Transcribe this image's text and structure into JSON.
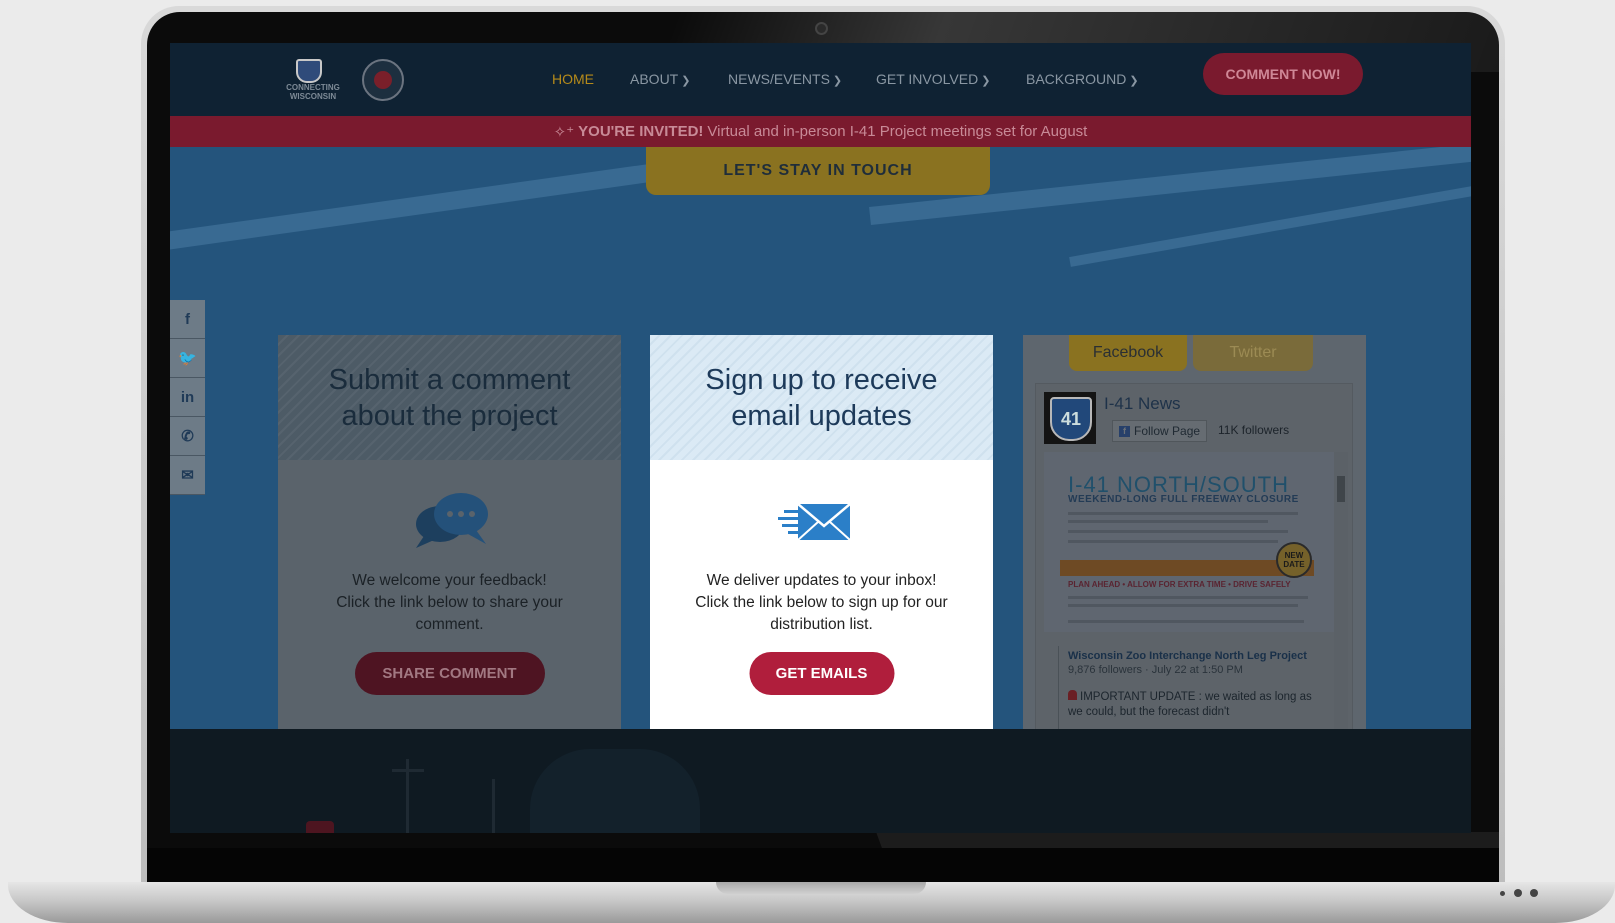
{
  "nav": {
    "logo_text": "CONNECTING WISCONSIN",
    "items": [
      {
        "label": "HOME",
        "chevron": false
      },
      {
        "label": "ABOUT",
        "chevron": true
      },
      {
        "label": "NEWS/EVENTS",
        "chevron": true
      },
      {
        "label": "GET INVOLVED",
        "chevron": true
      },
      {
        "label": "BACKGROUND",
        "chevron": true
      }
    ],
    "cta_label": "COMMENT NOW!"
  },
  "banner": {
    "icon": "sparkle-icon",
    "bold": "YOU'RE INVITED!",
    "text": "Virtual and in-person I-41 Project meetings set for August"
  },
  "stay_in_touch": "LET'S STAY IN TOUCH",
  "social": [
    {
      "icon": "facebook-icon",
      "glyph": "f"
    },
    {
      "icon": "twitter-icon",
      "glyph": "🐦"
    },
    {
      "icon": "linkedin-icon",
      "glyph": "in"
    },
    {
      "icon": "whatsapp-icon",
      "glyph": "✆"
    },
    {
      "icon": "email-icon",
      "glyph": "✉"
    }
  ],
  "cards": {
    "comment": {
      "title_line1": "Submit a comment",
      "title_line2": "about the project",
      "text_line1": "We welcome your feedback!",
      "text_line2": "Click the link below to share your",
      "text_line3": "comment.",
      "button": "SHARE COMMENT"
    },
    "email": {
      "title_line1": "Sign up to receive",
      "title_line2": "email updates",
      "text_line1": "We deliver updates to your inbox!",
      "text_line2": "Click the link below to sign up for our",
      "text_line3": "distribution list.",
      "button": "GET EMAILS"
    }
  },
  "feed": {
    "tabs": [
      "Facebook",
      "Twitter"
    ],
    "page_name": "I-41 News",
    "shield_number": "41",
    "follow_label": "Follow Page",
    "followers": "11K followers",
    "post_title": "I-41 NORTH/SOUTH",
    "post_subtitle": "WEEKEND-LONG FULL FREEWAY CLOSURE",
    "post_badge": "NEW DATE",
    "post_plan": "PLAN AHEAD • ALLOW FOR EXTRA TIME • DRIVE SAFELY",
    "meta_title": "Wisconsin Zoo Interchange North Leg Project",
    "meta_sub": "9,876 followers · July 22 at 1:50 PM",
    "update_text": "IMPORTANT UPDATE : we waited as long as we could, but the forecast didn't"
  },
  "colors": {
    "nav_bg": "#0f2233",
    "accent_red": "#b01e3c",
    "accent_gold": "#8a7220",
    "page_blue": "#24547c"
  }
}
